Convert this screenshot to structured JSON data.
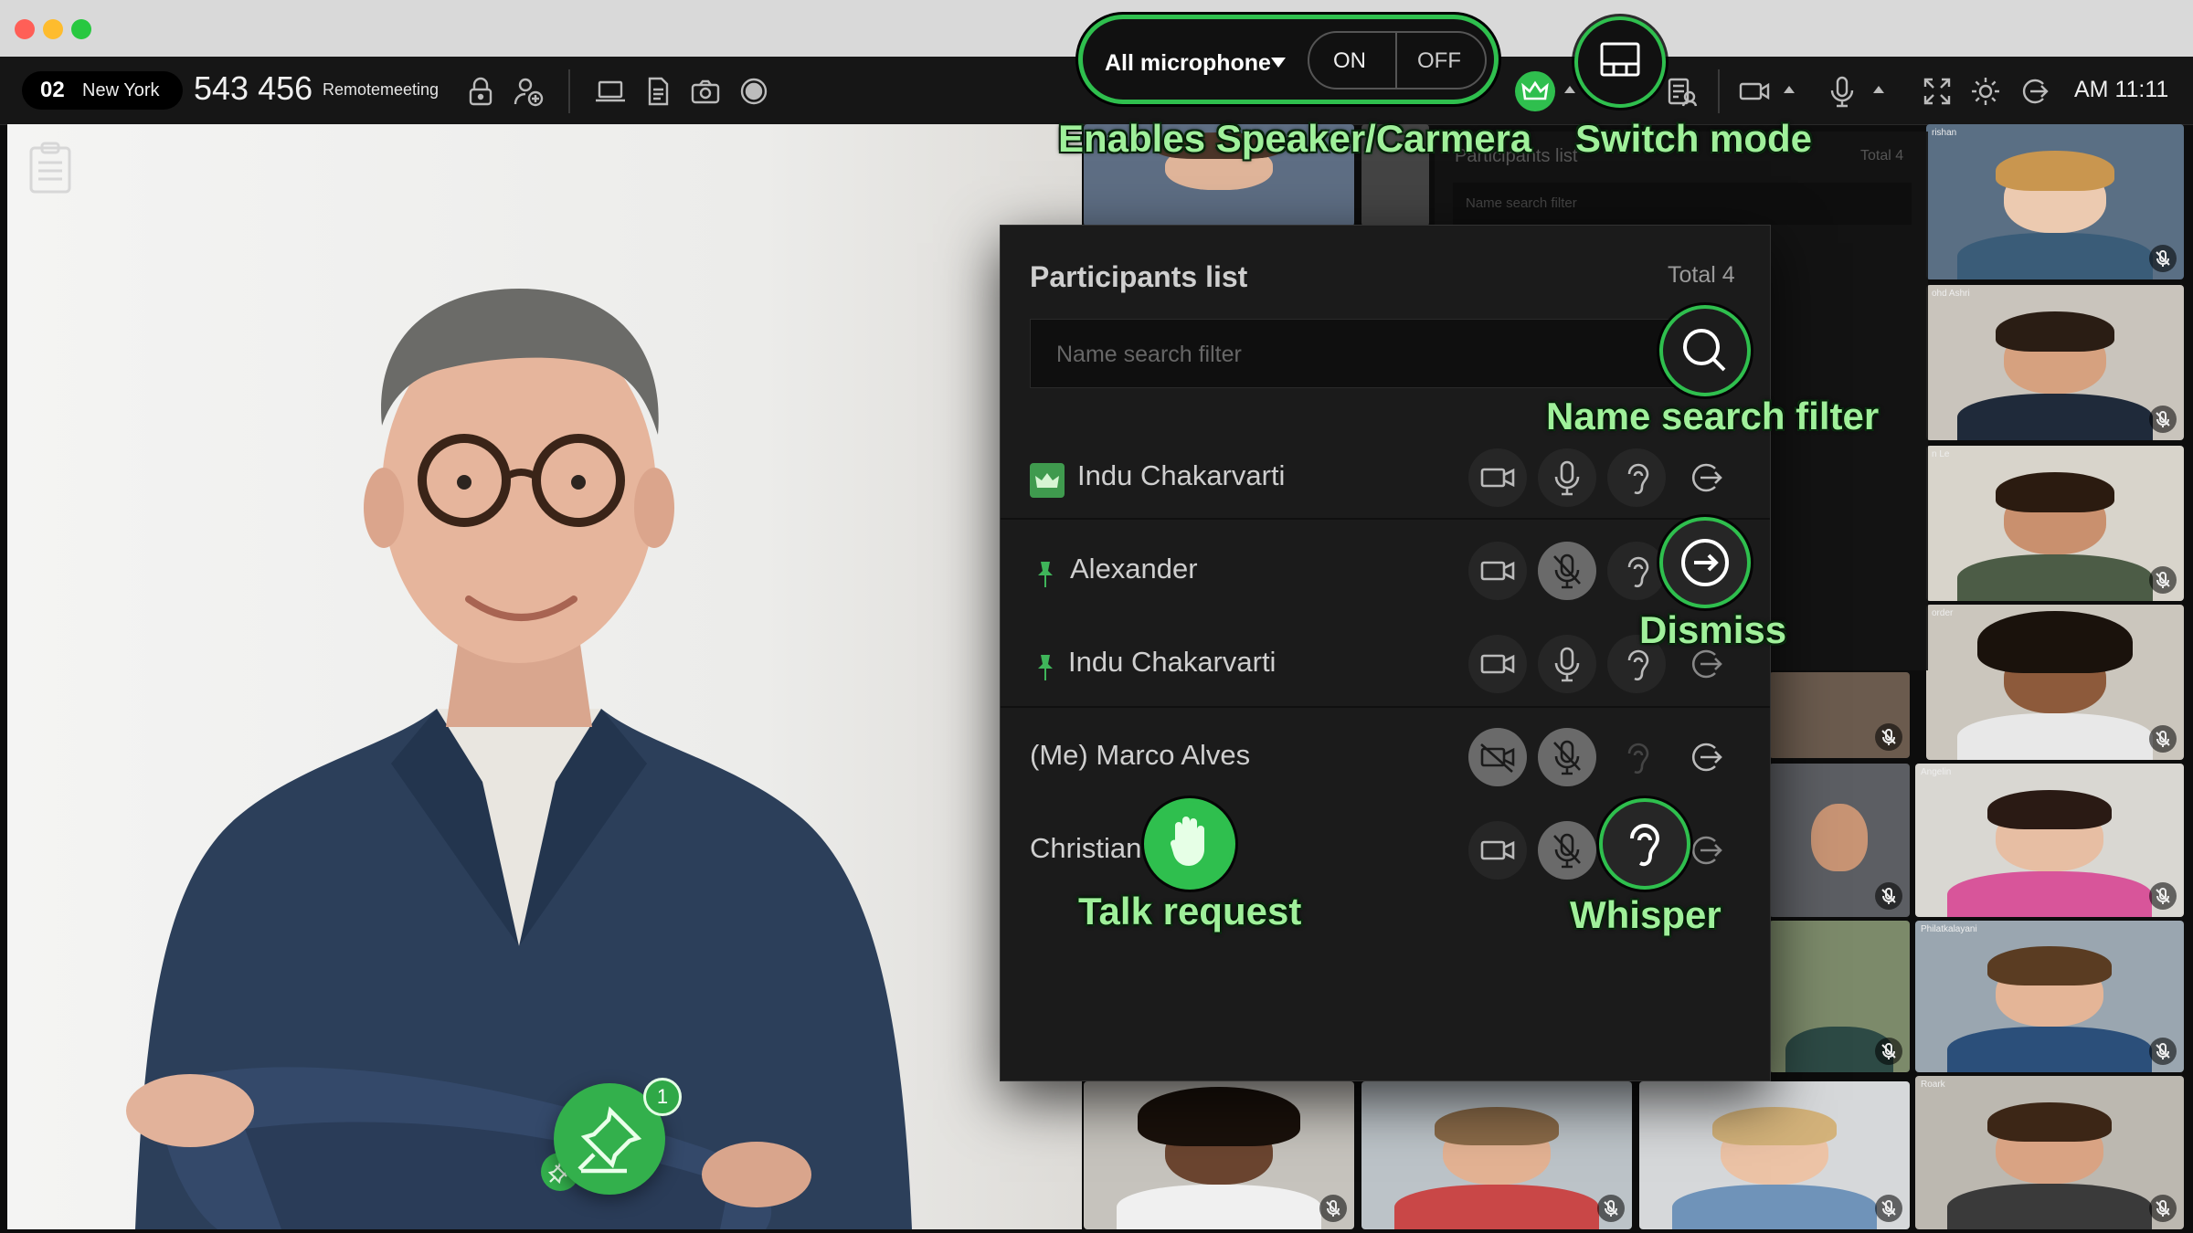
{
  "toolbar": {
    "room_number": "02",
    "room_city": "New York",
    "meeting_id": "543 456",
    "meeting_name": "Remotemeeting",
    "clock": "AM 11:11"
  },
  "mic_control": {
    "label": "All microphone",
    "on_label": "ON",
    "off_label": "OFF"
  },
  "callouts": {
    "enables_speaker": "Enables Speaker/Carmera",
    "switch_mode": "Switch mode",
    "name_search": "Name search filter",
    "dismiss": "Dismiss",
    "talk_request": "Talk request",
    "whisper": "Whisper"
  },
  "panel": {
    "title": "Participants list",
    "total": "Total 4",
    "search_placeholder": "Name search filter",
    "participants": [
      {
        "name": "Indu Chakarvarti",
        "badge": "crown",
        "mic_muted": false,
        "camera_off": false
      },
      {
        "name": "Alexander",
        "badge": "pin",
        "mic_muted": true,
        "camera_off": false
      },
      {
        "name": "Indu Chakarvarti",
        "badge": "pin",
        "mic_muted": false,
        "camera_off": false
      },
      {
        "name": "(Me) Marco Alves",
        "badge": "",
        "mic_muted": true,
        "camera_off": true
      },
      {
        "name": "Christian",
        "badge": "",
        "mic_muted": true,
        "camera_off": false
      }
    ]
  },
  "back_panel": {
    "title": "Participants list",
    "total": "Total 4",
    "search_placeholder": "Name search filter"
  },
  "thumb_names": {
    "t1": "rishan",
    "t2": "ohd Ashri",
    "t3": "n Le",
    "t4": "order",
    "t5": "Angelin",
    "t6": "Philatkalayani",
    "t7": "Roark"
  },
  "fab": {
    "badge_count": "1"
  },
  "colors": {
    "accent_green": "#2fbf4e",
    "callout_text": "#9ff09a",
    "panel_bg": "#1b1b1b",
    "toolbar_bg": "#161616"
  }
}
